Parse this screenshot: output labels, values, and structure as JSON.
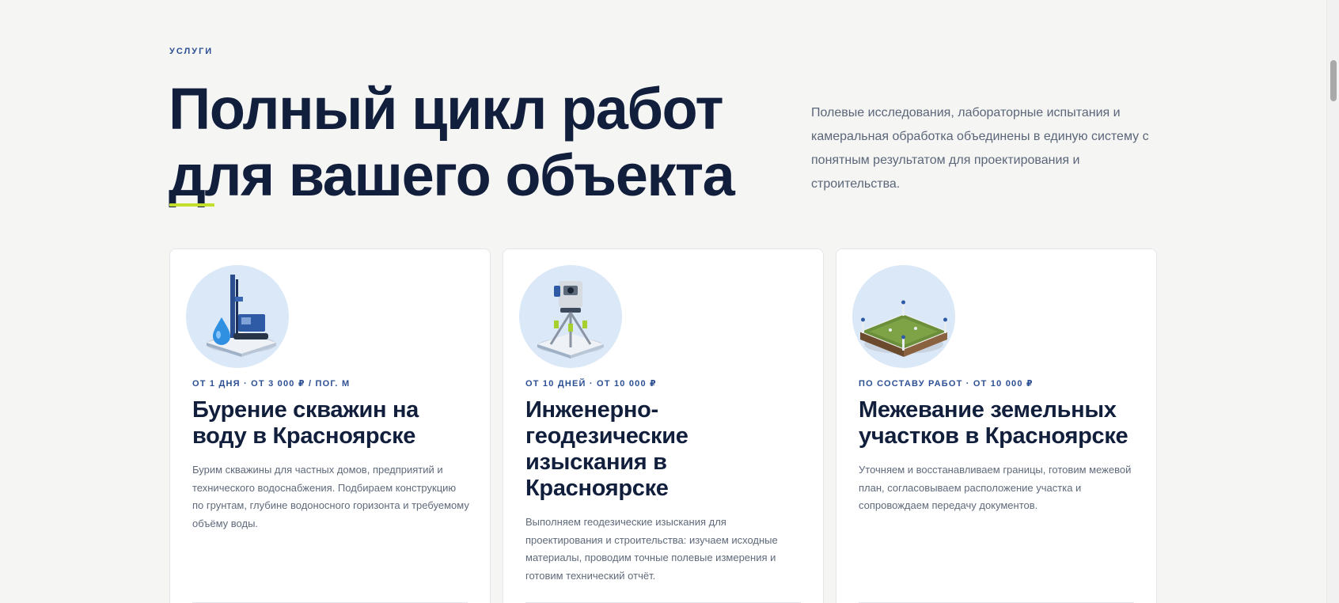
{
  "section": {
    "eyebrow": "Услуги",
    "title": "Полный цикл работ для вашего объекта",
    "description": "Полевые исследования, лабораторные испытания и камеральная обработка объединены в единую систему с понятным результатом для проектирования и строительства."
  },
  "services": [
    {
      "meta": "От 1 дня · от 3 000 ₽ / пог. м",
      "title": "Бурение скважин на воду в Красноярске",
      "text": "Бурим скважины для частных домов, предприятий и технического водоснабжения. Подбираем конструкцию по грунтам, глубине водоносного горизонта и требуемому объёму воды.",
      "icon": "drilling-rig-icon"
    },
    {
      "meta": "От 10 дней · от 10 000 ₽",
      "title": "Инженерно-геодезические изыскания в Красноярске",
      "text": "Выполняем геодезические изыскания для проектирования и строительства: изучаем исходные материалы, проводим точные полевые измерения и готовим технический отчёт.",
      "icon": "theodolite-icon"
    },
    {
      "meta": "По составу работ · от 10 000 ₽",
      "title": "Межевание земельных участков в Красноярске",
      "text": "Уточняем и восстанавливаем границы, готовим межевой план, согласовываем расположение участка и сопровождаем передачу документов.",
      "icon": "land-plot-icon"
    }
  ],
  "colors": {
    "accent": "#c3df2c",
    "primary_dark": "#111f3c",
    "eyebrow_blue": "#2c4f93",
    "background": "#f5f5f4"
  }
}
